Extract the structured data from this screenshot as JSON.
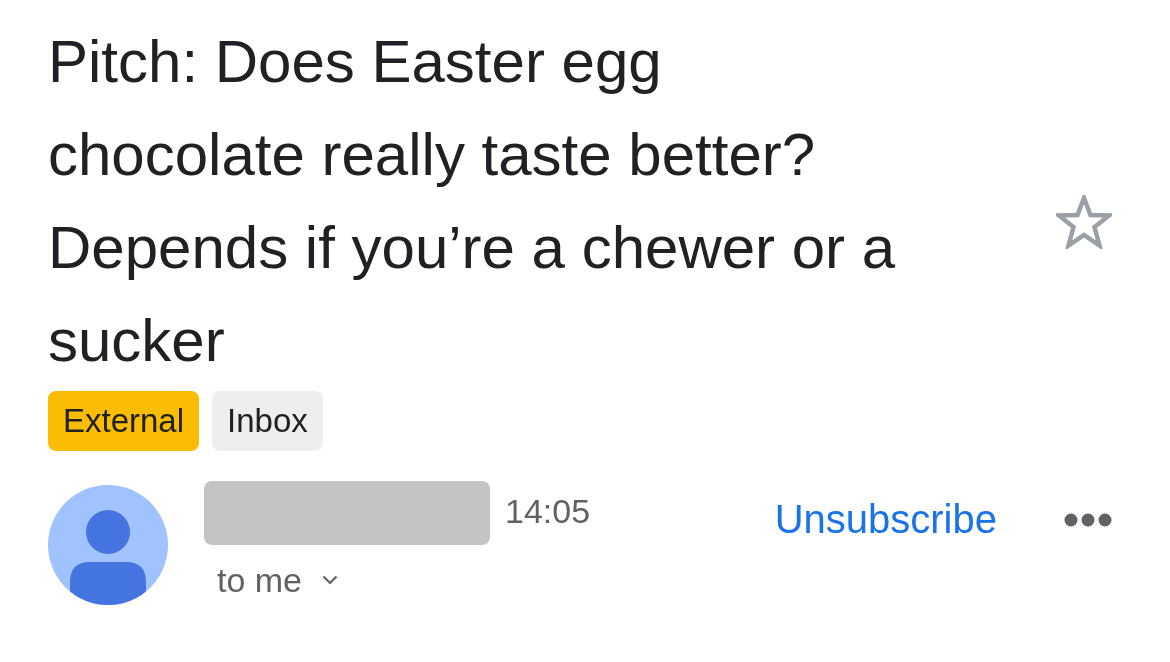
{
  "subject": {
    "title": "Pitch: Does Easter egg chocolate really taste better? Depends if you’re a chewer or a sucker",
    "labels": [
      {
        "text": "External",
        "color": "#fbbc04"
      },
      {
        "text": "Inbox",
        "color": "#eeeeee"
      }
    ],
    "starred": false
  },
  "message": {
    "time": "14:05",
    "recipient": "to me",
    "unsubscribe": "Unsubscribe"
  }
}
